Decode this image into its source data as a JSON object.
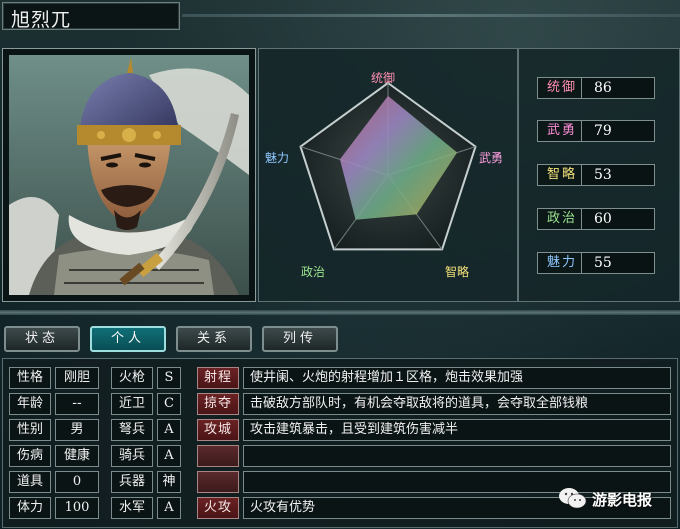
{
  "character": {
    "name": "旭烈兀"
  },
  "radar": {
    "labels": {
      "leadership": "统御",
      "valor": "武勇",
      "intellect": "智略",
      "politics": "政治",
      "charisma": "魅力"
    },
    "values": {
      "leadership": 86,
      "valor": 79,
      "intellect": 53,
      "politics": 60,
      "charisma": 55
    },
    "max": 100
  },
  "stats": [
    {
      "label": "统御",
      "value": "86",
      "color": "#ff8fb0"
    },
    {
      "label": "武勇",
      "value": "79",
      "color": "#ff8fd8"
    },
    {
      "label": "智略",
      "value": "53",
      "color": "#f3e27a"
    },
    {
      "label": "政治",
      "value": "60",
      "color": "#9be38e"
    },
    {
      "label": "魅力",
      "value": "55",
      "color": "#8ec8ff"
    }
  ],
  "tabs": [
    {
      "label": "状态",
      "active": false
    },
    {
      "label": "个人",
      "active": true
    },
    {
      "label": "关系",
      "active": false
    },
    {
      "label": "列传",
      "active": false
    }
  ],
  "attributes": [
    {
      "label": "性格",
      "value": "刚胆"
    },
    {
      "label": "年龄",
      "value": "--"
    },
    {
      "label": "性别",
      "value": "男"
    },
    {
      "label": "伤病",
      "value": "健康"
    },
    {
      "label": "道具",
      "value": "0"
    },
    {
      "label": "体力",
      "value": "100"
    }
  ],
  "aptitudes": [
    {
      "label": "火枪",
      "value": "S"
    },
    {
      "label": "近卫",
      "value": "C"
    },
    {
      "label": "弩兵",
      "value": "A"
    },
    {
      "label": "骑兵",
      "value": "A"
    },
    {
      "label": "兵器",
      "value": "神"
    },
    {
      "label": "水军",
      "value": "A"
    }
  ],
  "skills": [
    {
      "name": "射程",
      "desc": "使井阑、火炮的射程增加１区格，炮击效果加强"
    },
    {
      "name": "掠夺",
      "desc": "击破敌方部队时，有机会夺取敌将的道具，会夺取全部钱粮"
    },
    {
      "name": "攻城",
      "desc": "攻击建筑暴击，且受到建筑伤害减半"
    },
    {
      "name": "",
      "desc": ""
    },
    {
      "name": "",
      "desc": ""
    },
    {
      "name": "火攻",
      "desc": "火攻有优势"
    }
  ],
  "watermark": {
    "text": "游影电报",
    "icon": "wechat-icon"
  },
  "colors": {
    "skill_tag": "#6b2224",
    "active_tab": "#0f6f77"
  }
}
